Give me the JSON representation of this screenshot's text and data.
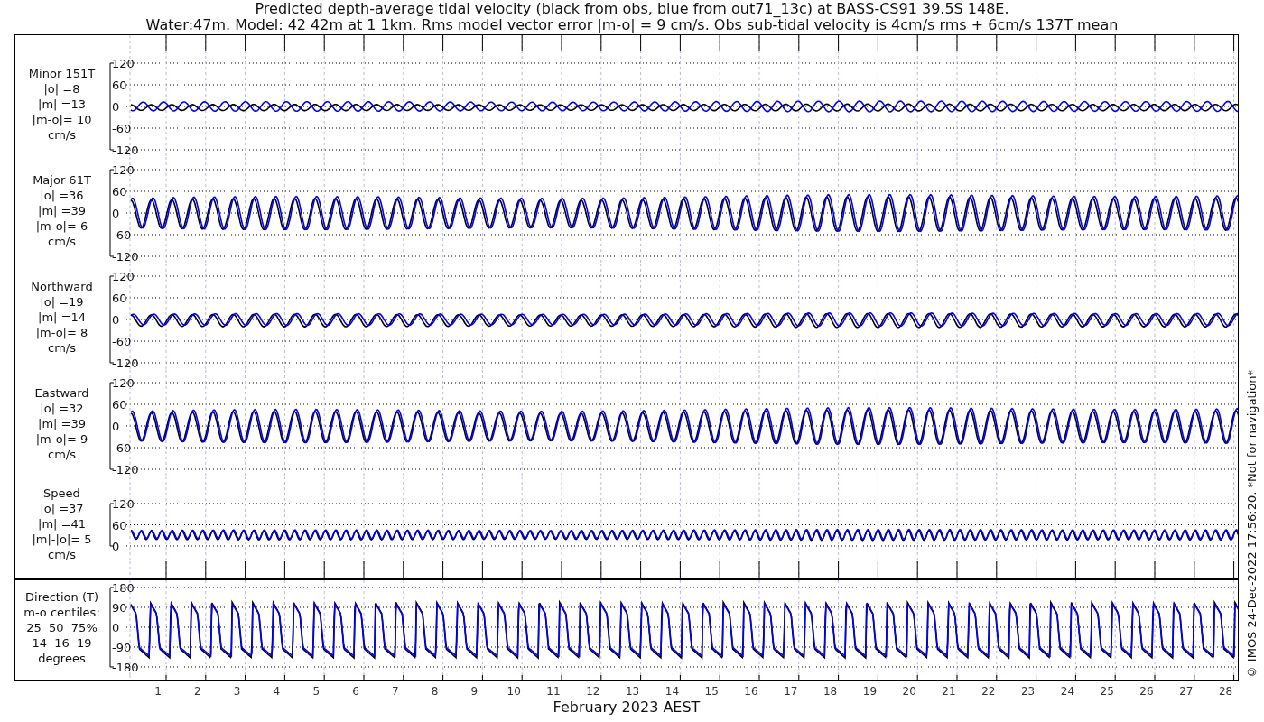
{
  "title": [
    "Predicted depth-average tidal velocity (black from obs, blue from out71_13c) at BASS-CS91 39.5S 148E.",
    "Water:47m. Model: 42 42m at 1 1km. Rms model vector error |m-o| = 9 cm/s. Obs sub-tidal velocity is 4cm/s rms + 6cm/s 137T mean"
  ],
  "panels": [
    {
      "kind": "signed",
      "label": [
        "Minor 151T",
        "|o| =8",
        "|m| =13",
        "|m-o|= 10",
        "cm/s"
      ],
      "yticks": [
        "120",
        "60",
        "0",
        "-60",
        "-120"
      ]
    },
    {
      "kind": "signed",
      "label": [
        "Major 61T",
        "|o| =36",
        "|m| =39",
        "|m-o|= 6",
        "cm/s"
      ],
      "yticks": [
        "120",
        "60",
        "0",
        "-60",
        "-120"
      ]
    },
    {
      "kind": "signed",
      "label": [
        "Northward",
        "|o| =19",
        "|m| =14",
        "|m-o|= 8",
        "cm/s"
      ],
      "yticks": [
        "120",
        "60",
        "0",
        "-60",
        "-120"
      ]
    },
    {
      "kind": "signed",
      "label": [
        "Eastward",
        "|o| =32",
        "|m| =39",
        "|m-o|= 9",
        "cm/s"
      ],
      "yticks": [
        "120",
        "60",
        "0",
        "-60",
        "-120"
      ]
    },
    {
      "kind": "speed",
      "label": [
        "Speed",
        "|o| =37",
        "|m| =41",
        "|m|-|o|= 5",
        "cm/s"
      ],
      "yticks": [
        "120",
        "60",
        "0"
      ]
    },
    {
      "kind": "direction",
      "label": [
        "Direction (T)",
        "m-o centiles:",
        "25  50  75%",
        "14  16  19",
        "degrees"
      ],
      "yticks": [
        "180",
        "90",
        "0",
        "-90",
        "-180"
      ]
    }
  ],
  "xticks": [
    "1",
    "2",
    "3",
    "4",
    "5",
    "6",
    "7",
    "8",
    "9",
    "10",
    "11",
    "12",
    "13",
    "14",
    "15",
    "16",
    "17",
    "18",
    "19",
    "20",
    "21",
    "22",
    "23",
    "24",
    "25",
    "26",
    "27",
    "28"
  ],
  "xlabel": "February 2023 AEST",
  "footer_note": "© IMOS 24-Dec-2022 17:56:20. *Not for navigation*"
}
